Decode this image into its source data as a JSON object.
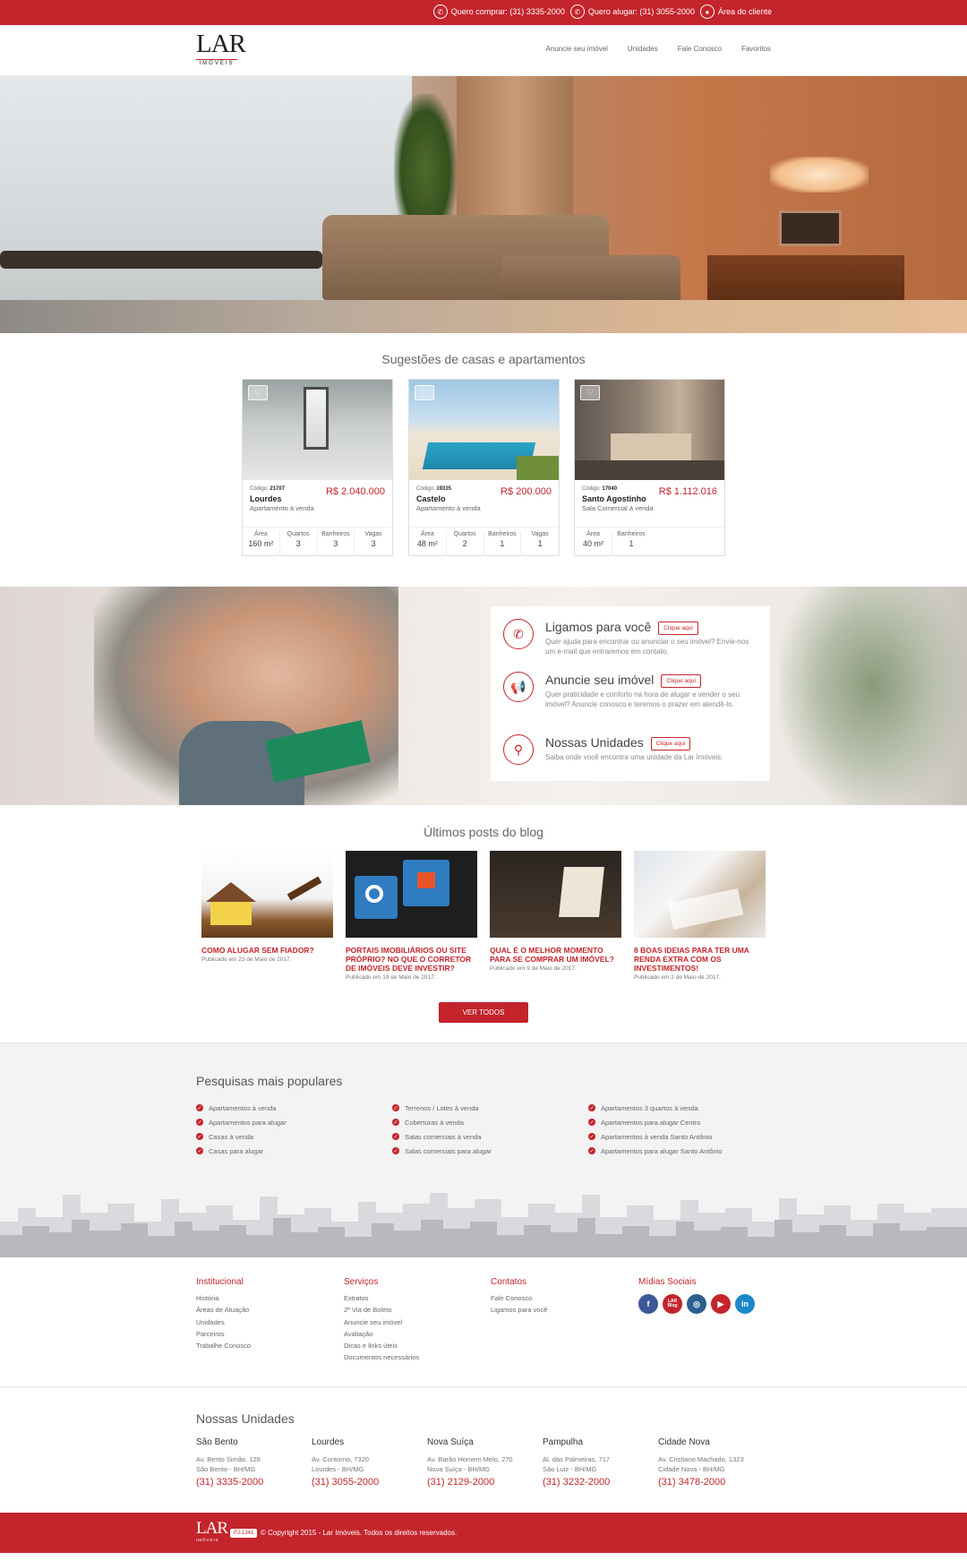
{
  "topbar": {
    "items": [
      {
        "icon": "phone-icon",
        "label": "Quero comprar: (31) 3335-2000"
      },
      {
        "icon": "phone-icon",
        "label": "Quero alugar: (31) 3055-2000"
      },
      {
        "icon": "user-icon",
        "label": "Área do cliente"
      }
    ]
  },
  "header": {
    "logo": {
      "main": "LAR",
      "sub": "IMÓVEIS"
    },
    "nav": [
      "Anuncie seu imóvel",
      "Unidades",
      "Fale Conosco",
      "Favoritos"
    ]
  },
  "suggestions": {
    "title": "Sugestões de casas e apartamentos",
    "cards": [
      {
        "code_label": "Código:",
        "code": "21707",
        "price": "R$ 2.040.000",
        "name": "Lourdes",
        "type": "Apartamento à venda",
        "stats": [
          {
            "label": "Área",
            "value": "160 m²"
          },
          {
            "label": "Quartos",
            "value": "3"
          },
          {
            "label": "Banheiros",
            "value": "3"
          },
          {
            "label": "Vagas",
            "value": "3"
          }
        ]
      },
      {
        "code_label": "Código:",
        "code": "19335",
        "price": "R$ 200.000",
        "name": "Castelo",
        "type": "Apartamento à venda",
        "stats": [
          {
            "label": "Área",
            "value": "48 m²"
          },
          {
            "label": "Quartos",
            "value": "2"
          },
          {
            "label": "Banheiros",
            "value": "1"
          },
          {
            "label": "Vagas",
            "value": "1"
          }
        ]
      },
      {
        "code_label": "Código:",
        "code": "17040",
        "price": "R$ 1.112.016",
        "name": "Santo Agostinho",
        "type": "Sala Comercial à venda",
        "stats": [
          {
            "label": "Área",
            "value": "40 m²"
          },
          {
            "label": "Banheiros",
            "value": "1"
          }
        ]
      }
    ]
  },
  "promo": {
    "rows": [
      {
        "icon": "phone-icon",
        "title": "Ligamos para você",
        "button": "Clique aqui",
        "desc": "Quer ajuda para encontrar ou anunciar o seu imóvel? Envie-nos um e-mail que entraremos em contato."
      },
      {
        "icon": "megaphone-icon",
        "title": "Anuncie seu imóvel",
        "button": "Clique aqui",
        "desc": "Quer praticidade e conforto na hora de alugar e vender o seu imóvel? Anuncie conosco e teremos o prazer em atendê-lo."
      },
      {
        "icon": "location-icon",
        "title": "Nossas Unidades",
        "button": "Clique aqui",
        "desc": "Saiba onde você encontra uma unidade da Lar Imóveis."
      }
    ]
  },
  "blog": {
    "title": "Últimos posts do blog",
    "posts": [
      {
        "title": "COMO ALUGAR SEM FIADOR?",
        "date": "Publicado em 23 de Maio de 2017."
      },
      {
        "title": "PORTAIS IMOBILIÁRIOS OU SITE PRÓPRIO? NO QUE O CORRETOR DE IMÓVEIS DEVE INVESTIR?",
        "date": "Publicado em 19 de Maio de 2017."
      },
      {
        "title": "QUAL É O MELHOR MOMENTO PARA SE COMPRAR UM IMÓVEL?",
        "date": "Publicado em 9 de Maio de 2017."
      },
      {
        "title": "8 BOAS IDEIAS PARA TER UMA RENDA EXTRA COM OS INVESTIMENTOS!",
        "date": "Publicado em 2 de Maio de 2017."
      }
    ],
    "button": "VER TODOS"
  },
  "popular": {
    "title": "Pesquisas mais populares",
    "columns": [
      [
        "Apartamentos à venda",
        "Apartamentos para alugar",
        "Casas à venda",
        "Casas para alugar"
      ],
      [
        "Terrenos / Lotes à venda",
        "Coberturas à venda",
        "Salas comerciais à venda",
        "Salas comerciais para alugar"
      ],
      [
        "Apartamentos 3 quartos à venda",
        "Apartamentos para alugar Centro",
        "Apartamentos à venda Santo Antônio",
        "Apartamentos para alugar Santo Antônio"
      ]
    ]
  },
  "footer": {
    "columns": [
      {
        "title": "Institucional",
        "links": [
          "História",
          "Áreas de Atuação",
          "Unidades",
          "Parceiros",
          "Trabalhe Conosco"
        ]
      },
      {
        "title": "Serviços",
        "links": [
          "Extratos",
          "2ª Via de Boleto",
          "Anuncie seu imóvel",
          "Avaliação",
          "Dicas e links úteis",
          "Documentos necessários"
        ]
      },
      {
        "title": "Contatos",
        "links": [
          "Fale Conosco",
          "Ligamos para você"
        ]
      }
    ],
    "social": {
      "title": "Mídias Sociais",
      "items": [
        {
          "icon": "facebook-icon",
          "glyph": "f",
          "color": "#3b5998"
        },
        {
          "icon": "lar-blog-icon",
          "glyph": "LAR Blog",
          "color": "#c4242b"
        },
        {
          "icon": "instagram-icon",
          "glyph": "◎",
          "color": "#2a5f8f"
        },
        {
          "icon": "youtube-icon",
          "glyph": "▶",
          "color": "#c4242b"
        },
        {
          "icon": "linkedin-icon",
          "glyph": "in",
          "color": "#1e88c7"
        }
      ]
    }
  },
  "units": {
    "title": "Nossas Unidades",
    "items": [
      {
        "name": "São Bento",
        "addr1": "Av. Bento Simão, 128",
        "addr2": "São Bento - BH/MG",
        "phone": "(31) 3335-2000"
      },
      {
        "name": "Lourdes",
        "addr1": "Av. Contorno, 7320",
        "addr2": "Lourdes - BH/MG",
        "phone": "(31) 3055-2000"
      },
      {
        "name": "Nova Suíça",
        "addr1": "Av. Barão Homem Melo, 270",
        "addr2": "Nova Suíça - BH/MG",
        "phone": "(31) 2129-2000"
      },
      {
        "name": "Pampulha",
        "addr1": "Al. das Palmeiras, 717",
        "addr2": "São Luiz - BH/MG",
        "phone": "(31) 3232-2000"
      },
      {
        "name": "Cidade Nova",
        "addr1": "Av. Cristiano Machado, 1323",
        "addr2": "Cidade Nova - BH/MG",
        "phone": "(31) 3478-2000"
      }
    ]
  },
  "bottom": {
    "logo": {
      "main": "LAR",
      "sub": "IMÓVEIS"
    },
    "badge": "PJ-1341",
    "copyright": "© Copyright 2015 - Lar Imóveis. Todos os direitos reservados."
  },
  "colors": {
    "brand": "#c4242b"
  }
}
